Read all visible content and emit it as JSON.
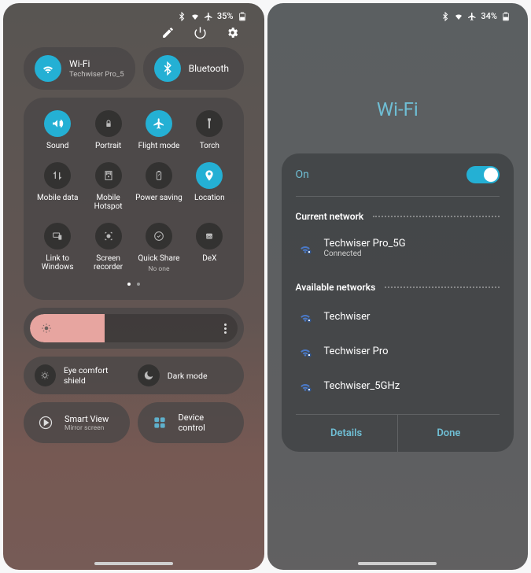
{
  "status": {
    "left_battery": "35%",
    "right_battery": "34%"
  },
  "quick": {
    "wifi": {
      "title": "Wi-Fi",
      "sub": "Techwiser Pro_5"
    },
    "bluetooth": {
      "title": "Bluetooth"
    },
    "items": [
      {
        "label": "Sound",
        "on": true
      },
      {
        "label": "Portrait",
        "on": false
      },
      {
        "label": "Flight mode",
        "on": true
      },
      {
        "label": "Torch",
        "on": false
      },
      {
        "label": "Mobile data",
        "on": false
      },
      {
        "label": "Mobile Hotspot",
        "on": false
      },
      {
        "label": "Power saving",
        "on": false
      },
      {
        "label": "Location",
        "on": true
      },
      {
        "label": "Link to Windows",
        "on": false
      },
      {
        "label": "Screen recorder",
        "on": false
      },
      {
        "label": "Quick Share",
        "on": false,
        "sub": "No one"
      },
      {
        "label": "DeX",
        "on": false
      }
    ],
    "eye_comfort": "Eye comfort shield",
    "dark_mode": "Dark mode",
    "smart_view": {
      "title": "Smart View",
      "sub": "Mirror screen"
    },
    "device_control": "Device control"
  },
  "wifi": {
    "page_title": "Wi-Fi",
    "on_label": "On",
    "current_header": "Current network",
    "available_header": "Available networks",
    "current": {
      "name": "Techwiser Pro_5G",
      "status": "Connected"
    },
    "available": [
      {
        "name": "Techwiser"
      },
      {
        "name": "Techwiser Pro"
      },
      {
        "name": "Techwiser_5GHz"
      }
    ],
    "details": "Details",
    "done": "Done"
  }
}
